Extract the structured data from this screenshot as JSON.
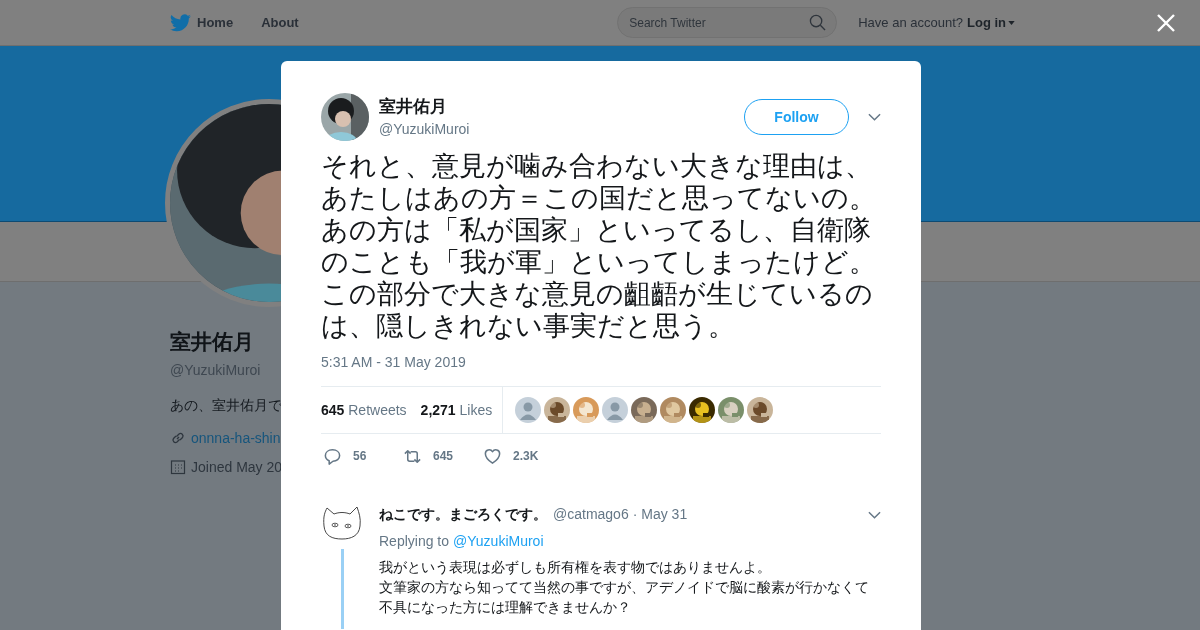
{
  "nav": {
    "items": [
      "Home",
      "About"
    ],
    "search": {
      "placeholder": "Search Twitter"
    },
    "account_prompt": "Have an account?",
    "login": "Log in"
  },
  "profile": {
    "name": "室井佑月",
    "handle": "@YuzukiMuroi",
    "bio": "あの、室井佑月で",
    "link": "onnna-ha-shin",
    "joined": "Joined May 20"
  },
  "tweet": {
    "name": "室井佑月",
    "handle": "@YuzukiMuroi",
    "follow": "Follow",
    "text": "それと、意見が噛み合わない大きな理由は、あたしはあの方＝この国だと思ってないの。あの方は「私が国家」といってるし、自衛隊のことも「我が軍」といってしまったけど。この部分で大きな意見の齟齬が生じているのは、隠しきれない事実だと思う。",
    "time": "5:31 AM - 31 May 2019",
    "stats": [
      {
        "count": "645",
        "label": "Retweets"
      },
      {
        "count": "2,271",
        "label": "Likes"
      }
    ],
    "likers": [
      {
        "kind": "default"
      },
      {
        "kind": "picture"
      },
      {
        "kind": "picture"
      },
      {
        "kind": "default"
      },
      {
        "kind": "picture"
      },
      {
        "kind": "picture"
      },
      {
        "kind": "picture"
      },
      {
        "kind": "picture"
      },
      {
        "kind": "picture"
      }
    ],
    "actions": [
      {
        "kind": "reply",
        "count": "56"
      },
      {
        "kind": "retweet",
        "count": "645"
      },
      {
        "kind": "like",
        "count": "2.3K"
      }
    ]
  },
  "reply": {
    "name": "ねこです。まごろくです。",
    "handle": "@catmago6",
    "date": "· May 31",
    "replying_to": "Replying to",
    "mention": "@YuzukiMuroi",
    "lines": [
      "我がという表現は必ずしも所有権を表す物ではありませんよ。",
      "文筆家の方なら知ってて当然の事ですが、アデノイドで脳に酸素が行かなくて",
      "不具になった方には理解できませんか？"
    ]
  }
}
